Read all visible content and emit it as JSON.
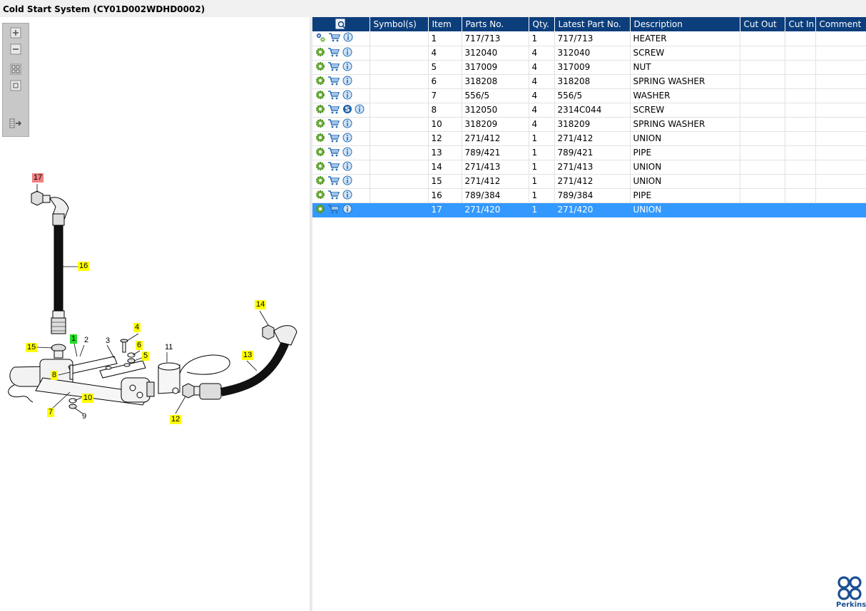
{
  "window": {
    "title": "Cold Start System (CY01D002WDHD0002)"
  },
  "toolbox": {
    "buttons": [
      {
        "name": "zoom-in-button",
        "icon": "plus-icon"
      },
      {
        "name": "zoom-out-button",
        "icon": "minus-icon"
      },
      {
        "name": "fit-all-button",
        "icon": "grid-icon"
      },
      {
        "name": "actual-size-button",
        "icon": "square-icon"
      },
      {
        "name": "panel-toggle-button",
        "icon": "sidebar-arrow-icon"
      }
    ]
  },
  "diagram": {
    "callouts": [
      {
        "label": "17",
        "style": "red"
      },
      {
        "label": "16",
        "style": "yellow"
      },
      {
        "label": "14",
        "style": "yellow"
      },
      {
        "label": "4",
        "style": "yellow"
      },
      {
        "label": "6",
        "style": "yellow"
      },
      {
        "label": "5",
        "style": "yellow"
      },
      {
        "label": "1",
        "style": "green"
      },
      {
        "label": "2",
        "style": "plain"
      },
      {
        "label": "3",
        "style": "plain"
      },
      {
        "label": "11",
        "style": "plain"
      },
      {
        "label": "15",
        "style": "yellow"
      },
      {
        "label": "13",
        "style": "yellow"
      },
      {
        "label": "8",
        "style": "yellow"
      },
      {
        "label": "10",
        "style": "yellow"
      },
      {
        "label": "7",
        "style": "yellow"
      },
      {
        "label": "9",
        "style": "plain"
      },
      {
        "label": "12",
        "style": "yellow"
      }
    ]
  },
  "table": {
    "headers": [
      "",
      "Symbol(s)",
      "Item",
      "Parts No.",
      "Qty.",
      "Latest Part No.",
      "Description",
      "Cut Out",
      "Cut In",
      "Comment"
    ],
    "rows": [
      {
        "icons": [
          "gears-icon",
          "cart-icon",
          "info-icon"
        ],
        "symbols": "",
        "item": "1",
        "part_no": "717/713",
        "qty": "1",
        "latest": "717/713",
        "desc": "HEATER",
        "cut_out": "",
        "cut_in": "",
        "comment": ""
      },
      {
        "icons": [
          "gear-icon",
          "cart-icon",
          "info-icon"
        ],
        "symbols": "",
        "item": "4",
        "part_no": "312040",
        "qty": "4",
        "latest": "312040",
        "desc": "SCREW",
        "cut_out": "",
        "cut_in": "",
        "comment": ""
      },
      {
        "icons": [
          "gear-icon",
          "cart-icon",
          "info-icon"
        ],
        "symbols": "",
        "item": "5",
        "part_no": "317009",
        "qty": "4",
        "latest": "317009",
        "desc": "NUT",
        "cut_out": "",
        "cut_in": "",
        "comment": ""
      },
      {
        "icons": [
          "gear-icon",
          "cart-icon",
          "info-icon"
        ],
        "symbols": "",
        "item": "6",
        "part_no": "318208",
        "qty": "4",
        "latest": "318208",
        "desc": "SPRING WASHER",
        "cut_out": "",
        "cut_in": "",
        "comment": ""
      },
      {
        "icons": [
          "gear-icon",
          "cart-icon",
          "info-icon"
        ],
        "symbols": "",
        "item": "7",
        "part_no": "556/5",
        "qty": "4",
        "latest": "556/5",
        "desc": "WASHER",
        "cut_out": "",
        "cut_in": "",
        "comment": ""
      },
      {
        "icons": [
          "gear-icon",
          "cart-icon",
          "supersession-icon",
          "info-icon"
        ],
        "symbols": "",
        "item": "8",
        "part_no": "312050",
        "qty": "4",
        "latest": "2314C044",
        "desc": "SCREW",
        "cut_out": "",
        "cut_in": "",
        "comment": ""
      },
      {
        "icons": [
          "gear-icon",
          "cart-icon",
          "info-icon"
        ],
        "symbols": "",
        "item": "10",
        "part_no": "318209",
        "qty": "4",
        "latest": "318209",
        "desc": "SPRING WASHER",
        "cut_out": "",
        "cut_in": "",
        "comment": ""
      },
      {
        "icons": [
          "gear-icon",
          "cart-icon",
          "info-icon"
        ],
        "symbols": "",
        "item": "12",
        "part_no": "271/412",
        "qty": "1",
        "latest": "271/412",
        "desc": "UNION",
        "cut_out": "",
        "cut_in": "",
        "comment": ""
      },
      {
        "icons": [
          "gear-icon",
          "cart-icon",
          "info-icon"
        ],
        "symbols": "",
        "item": "13",
        "part_no": "789/421",
        "qty": "1",
        "latest": "789/421",
        "desc": "PIPE",
        "cut_out": "",
        "cut_in": "",
        "comment": ""
      },
      {
        "icons": [
          "gear-icon",
          "cart-icon",
          "info-icon"
        ],
        "symbols": "",
        "item": "14",
        "part_no": "271/413",
        "qty": "1",
        "latest": "271/413",
        "desc": "UNION",
        "cut_out": "",
        "cut_in": "",
        "comment": ""
      },
      {
        "icons": [
          "gear-icon",
          "cart-icon",
          "info-icon"
        ],
        "symbols": "",
        "item": "15",
        "part_no": "271/412",
        "qty": "1",
        "latest": "271/412",
        "desc": "UNION",
        "cut_out": "",
        "cut_in": "",
        "comment": ""
      },
      {
        "icons": [
          "gear-icon",
          "cart-icon",
          "info-icon"
        ],
        "symbols": "",
        "item": "16",
        "part_no": "789/384",
        "qty": "1",
        "latest": "789/384",
        "desc": "PIPE",
        "cut_out": "",
        "cut_in": "",
        "comment": ""
      },
      {
        "icons": [
          "gear-icon",
          "cart-icon",
          "info-icon"
        ],
        "symbols": "",
        "item": "17",
        "part_no": "271/420",
        "qty": "1",
        "latest": "271/420",
        "desc": "UNION",
        "cut_out": "",
        "cut_in": "",
        "comment": "",
        "selected": true
      }
    ]
  },
  "brand": {
    "name": "Perkins",
    "color": "#1a4f92"
  },
  "colors": {
    "header_bg": "#0c3e7c",
    "selected_row": "#3399ff",
    "callout_yellow": "#ffff00",
    "callout_red": "#f08080",
    "callout_green": "#22dd22"
  }
}
